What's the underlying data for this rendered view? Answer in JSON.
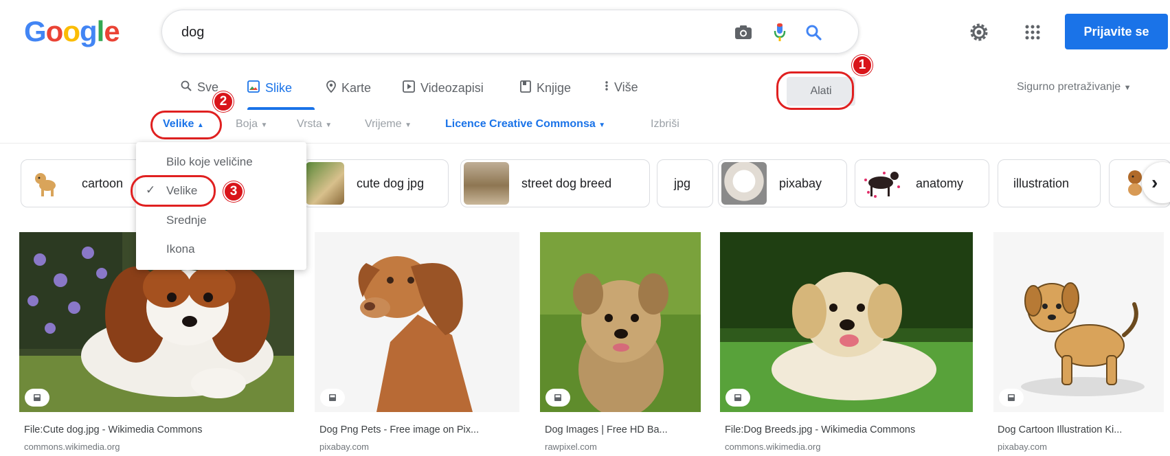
{
  "header": {
    "logo_letters": [
      "G",
      "o",
      "o",
      "g",
      "l",
      "e"
    ],
    "logo_colors": [
      "#4285f4",
      "#ea4335",
      "#fbbc05",
      "#4285f4",
      "#34a853",
      "#ea4335"
    ],
    "search_value": "dog",
    "signin_label": "Prijavite se"
  },
  "tabs": [
    {
      "label": "Sve",
      "icon": "search-icon"
    },
    {
      "label": "Slike",
      "icon": "image-icon"
    },
    {
      "label": "Karte",
      "icon": "map-pin-icon"
    },
    {
      "label": "Videozapisi",
      "icon": "play-icon"
    },
    {
      "label": "Knjige",
      "icon": "book-icon"
    },
    {
      "label": "Više",
      "icon": "more-icon"
    }
  ],
  "tools_label": "Alati",
  "safe_search_label": "Sigurno pretraživanje",
  "filters": [
    {
      "label": "Velike"
    },
    {
      "label": "Boja"
    },
    {
      "label": "Vrsta"
    },
    {
      "label": "Vrijeme"
    },
    {
      "label": "Licence Creative Commonsa"
    },
    {
      "label": "Izbriši"
    }
  ],
  "size_menu": {
    "options": [
      "Bilo koje veličine",
      "Velike",
      "Srednje",
      "Ikona"
    ],
    "selected": "Velike"
  },
  "annotations": [
    "1",
    "2",
    "3"
  ],
  "chips": [
    {
      "label": "cartoon"
    },
    {
      "label": "cute dog jpg"
    },
    {
      "label": "street dog breed"
    },
    {
      "label": "jpg"
    },
    {
      "label": "pixabay"
    },
    {
      "label": "anatomy"
    },
    {
      "label": "illustration"
    }
  ],
  "results": [
    {
      "title": "File:Cute dog.jpg - Wikimedia Commons",
      "source": "commons.wikimedia.org"
    },
    {
      "title": "Dog Png Pets - Free image on Pix...",
      "source": "pixabay.com"
    },
    {
      "title": "Dog Images | Free HD Ba...",
      "source": "rawpixel.com"
    },
    {
      "title": "File:Dog Breeds.jpg - Wikimedia Commons",
      "source": "commons.wikimedia.org"
    },
    {
      "title": "Dog Cartoon Illustration Ki...",
      "source": "pixabay.com"
    }
  ],
  "colors": {
    "accent": "#1a73e8",
    "annotation_red": "#d9141a"
  }
}
